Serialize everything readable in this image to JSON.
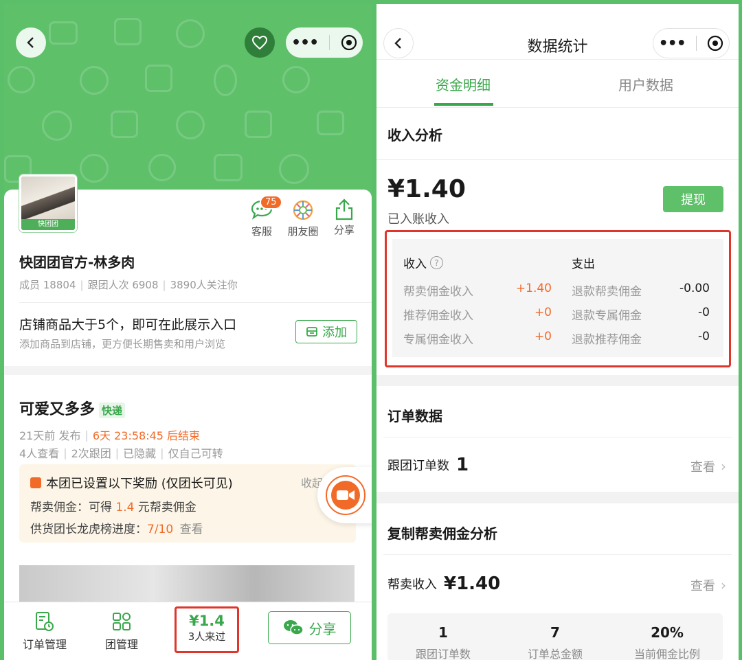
{
  "left": {
    "shop": {
      "avatar_badge": "快团团",
      "name": "快团团官方-林多肉",
      "stats": [
        "成员 18804",
        "跟团人次 6908",
        "3890人关注你"
      ]
    },
    "actions": [
      {
        "icon": "chat-icon",
        "label": "客服",
        "badge": "75"
      },
      {
        "icon": "moments-icon",
        "label": "朋友圈"
      },
      {
        "icon": "share-upload-icon",
        "label": "分享"
      }
    ],
    "promo": {
      "title": "店铺商品大于5个，即可在此展示入口",
      "subtitle": "添加商品到店铺，更方便长期售卖和用户浏览",
      "button": "添加"
    },
    "post": {
      "title": "可爱又多多",
      "tag": "快递",
      "published": "21天前 发布",
      "countdown": "6天 23:58:45 后结束",
      "meta": [
        "4人查看",
        "2次跟团",
        "已隐藏",
        "仅自己可转"
      ],
      "reward_title": "本团已设置以下奖励 (仅团长可见)",
      "reward_collapse": "收起",
      "commission_prefix": "帮卖佣金：可得 ",
      "commission_value": "1.4",
      "commission_suffix": " 元帮卖佣金",
      "progress_prefix": "供货团长龙虎榜进度：",
      "progress_value": "7/10",
      "progress_link": "查看"
    },
    "tabbar": {
      "orders": "订单管理",
      "team": "团管理",
      "amount": "¥1.4",
      "visitors": "3人来过",
      "share": "分享"
    }
  },
  "right": {
    "title": "数据统计",
    "tabs": [
      "资金明细",
      "用户数据"
    ],
    "income_section": "收入分析",
    "balance": "¥1.40",
    "balance_label": "已入账收入",
    "withdraw": "提现",
    "income_header": "收入",
    "expense_header": "支出",
    "income_rows": [
      {
        "label": "帮卖佣金收入",
        "value": "+1.40"
      },
      {
        "label": "推荐佣金收入",
        "value": "+0"
      },
      {
        "label": "专属佣金收入",
        "value": "+0"
      }
    ],
    "expense_rows": [
      {
        "label": "退款帮卖佣金",
        "value": "-0.00"
      },
      {
        "label": "退款专属佣金",
        "value": "-0"
      },
      {
        "label": "退款推荐佣金",
        "value": "-0"
      }
    ],
    "order_section": "订单数据",
    "order_label": "跟团订单数",
    "order_value": "1",
    "view": "查看",
    "copy_section": "复制帮卖佣金分析",
    "help_label": "帮卖收入",
    "help_value": "¥1.40",
    "stats": [
      {
        "value": "1",
        "label": "跟团订单数"
      },
      {
        "value": "7",
        "label": "订单总金额"
      },
      {
        "value": "20%",
        "label": "当前佣金比例"
      }
    ]
  },
  "colors": {
    "brand_green": "#5fc06a",
    "accent_orange": "#f26a28",
    "highlight_red": "#e0352b"
  }
}
